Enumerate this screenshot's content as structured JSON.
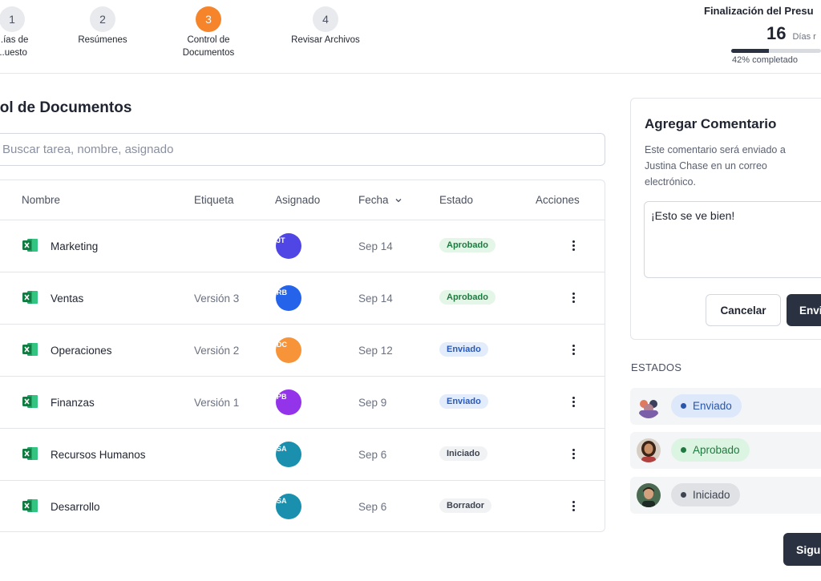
{
  "stepper": {
    "steps": [
      {
        "number": "1",
        "label": "...ías de\n...uesto"
      },
      {
        "number": "2",
        "label": "Resúmenes"
      },
      {
        "number": "3",
        "label": "Control de\nDocumentos"
      },
      {
        "number": "4",
        "label": "Revisar Archivos"
      }
    ],
    "active_step": 3,
    "accent_color": "#f5842a"
  },
  "deadline": {
    "title": "Finalización del Presu",
    "days": "16",
    "unit": "Días r",
    "progress_percent": 42,
    "progress_text": "42% completado"
  },
  "main": {
    "title": "trol de Documentos",
    "search_placeholder": "Buscar tarea, nombre, asignado"
  },
  "table": {
    "headers": {
      "name": "Nombre",
      "tag": "Etiqueta",
      "assigned": "Asignado",
      "date": "Fecha",
      "state": "Estado",
      "actions": "Acciones"
    },
    "rows": [
      {
        "name": "Marketing",
        "tag": "",
        "avatar_initials": "JT",
        "avatar_color": "#4f46e5",
        "date": "Sep 14",
        "state": "Aprobado",
        "state_color": "green"
      },
      {
        "name": "Ventas",
        "tag": "Versión 3",
        "avatar_initials": "RB",
        "avatar_color": "#2563eb",
        "date": "Sep 14",
        "state": "Aprobado",
        "state_color": "green"
      },
      {
        "name": "Operaciones",
        "tag": "Versión 2",
        "avatar_initials": "DC",
        "avatar_color": "#f7943a",
        "date": "Sep 12",
        "state": "Enviado",
        "state_color": "blue"
      },
      {
        "name": "Finanzas",
        "tag": "Versión 1",
        "avatar_initials": "PB",
        "avatar_color": "#9333ea",
        "date": "Sep 9",
        "state": "Enviado",
        "state_color": "blue"
      },
      {
        "name": "Recursos Humanos",
        "tag": "",
        "avatar_initials": "SA",
        "avatar_color": "#1b8fae",
        "date": "Sep 6",
        "state": "Iniciado",
        "state_color": "gray"
      },
      {
        "name": "Desarrollo",
        "tag": "",
        "avatar_initials": "SA",
        "avatar_color": "#1b8fae",
        "date": "Sep 6",
        "state": "Borrador",
        "state_color": "gray"
      }
    ]
  },
  "comment": {
    "title": "Agregar Comentario",
    "description": "Este comentario será enviado a Justina Chase en un correo electrónico.",
    "value": "¡Esto se ve bien!",
    "cancel_label": "Cancelar",
    "send_label": "Envi"
  },
  "states": {
    "title": "ESTADOS",
    "items": [
      {
        "label": "Enviado",
        "color": "blue"
      },
      {
        "label": "Aprobado",
        "color": "green"
      },
      {
        "label": "Iniciado",
        "color": "gray"
      }
    ]
  },
  "next_label": "Sigu"
}
